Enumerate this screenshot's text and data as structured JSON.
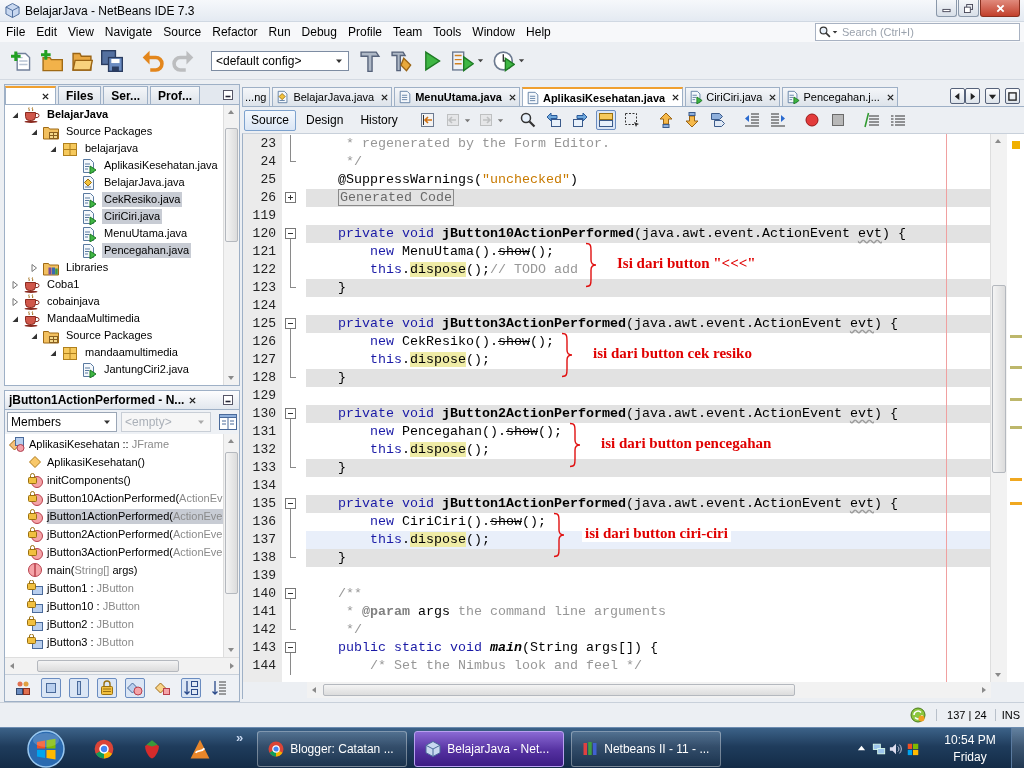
{
  "window": {
    "title": "BelajarJava - NetBeans IDE 7.3"
  },
  "menu": [
    "File",
    "Edit",
    "View",
    "Navigate",
    "Source",
    "Refactor",
    "Run",
    "Debug",
    "Profile",
    "Team",
    "Tools",
    "Window",
    "Help"
  ],
  "search": {
    "placeholder": "Search (Ctrl+I)"
  },
  "toolbar": {
    "file_tools": [
      {
        "kind": "new-file",
        "disabled": false,
        "dropdown": false
      },
      {
        "kind": "new-project",
        "disabled": false,
        "dropdown": false
      },
      {
        "kind": "open-project",
        "disabled": false,
        "dropdown": false
      },
      {
        "kind": "save-all",
        "disabled": false,
        "dropdown": false
      }
    ],
    "edit_tools": [
      {
        "kind": "undo",
        "disabled": false,
        "dropdown": false
      },
      {
        "kind": "redo",
        "disabled": true,
        "dropdown": false
      }
    ],
    "config": "<default config>",
    "run_tools": [
      {
        "kind": "build",
        "disabled": false,
        "dropdown": false
      },
      {
        "kind": "clean-build",
        "disabled": false,
        "dropdown": false
      },
      {
        "kind": "run",
        "disabled": false,
        "dropdown": false
      },
      {
        "kind": "debug",
        "disabled": false,
        "dropdown": true
      },
      {
        "kind": "profile",
        "disabled": false,
        "dropdown": true
      }
    ]
  },
  "projects": {
    "tabs": [
      {
        "selected": true,
        "closable": true
      },
      {
        "label": "Files",
        "selected": false,
        "closable": false
      },
      {
        "label": "Ser...",
        "selected": false,
        "closable": false
      },
      {
        "label": "Prof...",
        "selected": false,
        "closable": false
      }
    ],
    "tree": [
      {
        "label": "BelajarJava",
        "kind": "project",
        "main_project": true,
        "expanded": true,
        "selected": false,
        "children": [
          {
            "label": "Source Packages",
            "kind": "source-root",
            "expanded": true,
            "selected": false,
            "children": [
              {
                "label": "belajarjava",
                "kind": "package",
                "expanded": true,
                "selected": false,
                "children": [
                  {
                    "label": "AplikasiKesehatan.java",
                    "kind": "form",
                    "selected": false
                  },
                  {
                    "label": "BelajarJava.java",
                    "kind": "main",
                    "selected": false
                  },
                  {
                    "label": "CekResiko.java",
                    "kind": "form",
                    "selected": true
                  },
                  {
                    "label": "CiriCiri.java",
                    "kind": "form",
                    "selected": true
                  },
                  {
                    "label": "MenuUtama.java",
                    "kind": "form",
                    "selected": false
                  },
                  {
                    "label": "Pencegahan.java",
                    "kind": "form",
                    "selected": true
                  }
                ]
              }
            ]
          },
          {
            "label": "Libraries",
            "kind": "libraries",
            "expanded": false,
            "selected": false
          }
        ]
      },
      {
        "label": "Coba1",
        "kind": "project",
        "main_project": false,
        "expanded": false,
        "selected": false
      },
      {
        "label": "cobainjava",
        "kind": "project",
        "main_project": false,
        "expanded": false,
        "selected": false
      },
      {
        "label": "MandaaMultimedia",
        "kind": "project",
        "main_project": false,
        "expanded": true,
        "selected": false,
        "children": [
          {
            "label": "Source Packages",
            "kind": "source-root",
            "expanded": true,
            "selected": false,
            "children": [
              {
                "label": "mandaamultimedia",
                "kind": "package",
                "expanded": true,
                "selected": false,
                "children": [
                  {
                    "label": "JantungCiri2.java",
                    "kind": "form",
                    "selected": false
                  }
                ]
              }
            ]
          }
        ]
      }
    ]
  },
  "navigator": {
    "title": "jButton1ActionPerformed - N...",
    "filter": "Members",
    "scope": {
      "value": "<empty>",
      "disabled": true
    },
    "members": [
      {
        "kind": "class",
        "selected": false,
        "parts": [
          {
            "text": "AplikasiKesehatan :: ",
            "muted": false
          },
          {
            "text": "JFrame",
            "muted": true
          }
        ],
        "children": [
          {
            "kind": "constructor",
            "selected": false,
            "parts": [
              {
                "text": "AplikasiKesehatan()",
                "muted": false
              }
            ]
          },
          {
            "kind": "method",
            "selected": false,
            "parts": [
              {
                "text": "initComponents()",
                "muted": false
              }
            ]
          },
          {
            "kind": "method",
            "selected": false,
            "parts": [
              {
                "text": "jButton10ActionPerformed(",
                "muted": false
              },
              {
                "text": "ActionEv",
                "muted": true
              }
            ]
          },
          {
            "kind": "method",
            "selected": true,
            "parts": [
              {
                "text": "jButton1ActionPerformed(",
                "muted": false
              },
              {
                "text": "ActionEve",
                "muted": true
              }
            ]
          },
          {
            "kind": "method",
            "selected": false,
            "parts": [
              {
                "text": "jButton2ActionPerformed(",
                "muted": false
              },
              {
                "text": "ActionEve",
                "muted": true
              }
            ]
          },
          {
            "kind": "method",
            "selected": false,
            "parts": [
              {
                "text": "jButton3ActionPerformed(",
                "muted": false
              },
              {
                "text": "ActionEve",
                "muted": true
              }
            ]
          },
          {
            "kind": "static-method",
            "selected": false,
            "parts": [
              {
                "text": "main(",
                "muted": false
              },
              {
                "text": "String[]",
                "muted": true
              },
              {
                "text": " args)",
                "muted": false
              }
            ]
          },
          {
            "kind": "field",
            "selected": false,
            "parts": [
              {
                "text": "jButton1 : ",
                "muted": false
              },
              {
                "text": "JButton",
                "muted": true
              }
            ]
          },
          {
            "kind": "field",
            "selected": false,
            "parts": [
              {
                "text": "jButton10 : ",
                "muted": false
              },
              {
                "text": "JButton",
                "muted": true
              }
            ]
          },
          {
            "kind": "field",
            "selected": false,
            "parts": [
              {
                "text": "jButton2 : ",
                "muted": false
              },
              {
                "text": "JButton",
                "muted": true
              }
            ]
          },
          {
            "kind": "field",
            "selected": false,
            "parts": [
              {
                "text": "jButton3 : ",
                "muted": false
              },
              {
                "text": "JButton",
                "muted": true
              }
            ]
          }
        ]
      }
    ],
    "tools": [
      {
        "kind": "inherited",
        "pressed": false
      },
      {
        "kind": "fields",
        "pressed": true
      },
      {
        "kind": "static",
        "pressed": true
      },
      {
        "kind": "non-public",
        "pressed": true
      },
      {
        "kind": "inner",
        "pressed": true
      },
      {
        "kind": "javadoc",
        "pressed": false
      },
      {
        "kind": "sort-name",
        "pressed": true
      },
      {
        "kind": "sort-source",
        "pressed": false
      }
    ]
  },
  "editor": {
    "tabs": [
      {
        "label": "...ng",
        "kind": "partial",
        "selected": false,
        "modified": false
      },
      {
        "label": "BelajarJava.java",
        "kind": "main",
        "selected": false,
        "modified": false
      },
      {
        "label": "MenuUtama.java",
        "kind": "file",
        "selected": false,
        "modified": true
      },
      {
        "label": "AplikasiKesehatan.java",
        "kind": "file",
        "selected": true,
        "modified": true
      },
      {
        "label": "CiriCiri.java",
        "kind": "form",
        "selected": false,
        "modified": false
      },
      {
        "label": "Pencegahan.j...",
        "kind": "form",
        "selected": false,
        "modified": false
      }
    ],
    "views": [
      {
        "label": "Source",
        "selected": true
      },
      {
        "label": "Design",
        "selected": false
      },
      {
        "label": "History",
        "selected": false
      }
    ],
    "tool_groups": [
      [
        {
          "kind": "last-edit",
          "disabled": false,
          "pressed": false,
          "dropdown": false
        },
        {
          "kind": "back",
          "disabled": true,
          "pressed": false,
          "dropdown": true
        },
        {
          "kind": "forward",
          "disabled": true,
          "pressed": false,
          "dropdown": true
        }
      ],
      [
        {
          "kind": "find-selection",
          "disabled": false,
          "pressed": false,
          "dropdown": false
        },
        {
          "kind": "find-prev",
          "disabled": false,
          "pressed": false,
          "dropdown": false
        },
        {
          "kind": "find-next",
          "disabled": false,
          "pressed": false,
          "dropdown": false
        },
        {
          "kind": "toggle-highlight",
          "disabled": false,
          "pressed": true,
          "dropdown": false
        },
        {
          "kind": "rect-select",
          "disabled": false,
          "pressed": false,
          "dropdown": false
        }
      ],
      [
        {
          "kind": "prev-bookmark",
          "disabled": false,
          "pressed": false,
          "dropdown": false
        },
        {
          "kind": "next-bookmark",
          "disabled": false,
          "pressed": false,
          "dropdown": false
        },
        {
          "kind": "toggle-bookmark",
          "disabled": false,
          "pressed": false,
          "dropdown": false
        }
      ],
      [
        {
          "kind": "shift-left",
          "disabled": false,
          "pressed": false,
          "dropdown": false
        },
        {
          "kind": "shift-right",
          "disabled": false,
          "pressed": false,
          "dropdown": false
        }
      ],
      [
        {
          "kind": "record",
          "disabled": false,
          "pressed": false,
          "dropdown": false
        },
        {
          "kind": "stop",
          "disabled": false,
          "pressed": false,
          "dropdown": false
        }
      ],
      [
        {
          "kind": "comment",
          "disabled": false,
          "pressed": false,
          "dropdown": false
        },
        {
          "kind": "uncomment",
          "disabled": false,
          "pressed": false,
          "dropdown": false
        }
      ]
    ],
    "lines": [
      {
        "number": "23",
        "kind": "fold-body",
        "guarded": false,
        "current": false,
        "tokens": [
          {
            "text": "     * regenerated by the Form Editor.",
            "kind": "comment"
          }
        ]
      },
      {
        "number": "24",
        "kind": "fold-end",
        "guarded": false,
        "current": false,
        "tokens": [
          {
            "text": "     */",
            "kind": "comment"
          }
        ]
      },
      {
        "number": "25",
        "kind": "plain",
        "guarded": false,
        "current": false,
        "tokens": [
          {
            "text": "    @SuppressWarnings(",
            "kind": "plain"
          },
          {
            "text": "\"unchecked\"",
            "kind": "string"
          },
          {
            "text": ")",
            "kind": "plain"
          }
        ]
      },
      {
        "number": "26",
        "kind": "folded",
        "guarded": true,
        "current": false,
        "tokens": [
          {
            "text": "    Generated Code",
            "kind": "folded"
          }
        ]
      },
      {
        "number": "119",
        "kind": "plain",
        "guarded": false,
        "current": false
      },
      {
        "number": "120",
        "kind": "fold-start",
        "guarded": true,
        "current": false,
        "tokens": [
          {
            "text": "    private void ",
            "kind": "keyword"
          },
          {
            "text": "jButton10ActionPerformed",
            "kind": "declaration"
          },
          {
            "text": "(java.awt.event.ActionEvent ",
            "kind": "plain"
          },
          {
            "text": "evt",
            "kind": "unused"
          },
          {
            "text": ") {",
            "kind": "plain"
          }
        ]
      },
      {
        "number": "121",
        "kind": "fold-body",
        "guarded": false,
        "current": false,
        "tokens": [
          {
            "text": "        new ",
            "kind": "keyword"
          },
          {
            "text": "MenuUtama().",
            "kind": "plain"
          },
          {
            "text": "show",
            "kind": "deprecated"
          },
          {
            "text": "();",
            "kind": "plain"
          }
        ],
        "note": "Isi dari button \"<<<\""
      },
      {
        "number": "122",
        "kind": "fold-body",
        "guarded": false,
        "current": false,
        "tokens": [
          {
            "text": "        this",
            "kind": "keyword"
          },
          {
            "text": ".",
            "kind": "plain"
          },
          {
            "text": "dispose",
            "kind": "occurrence"
          },
          {
            "text": "();",
            "kind": "plain"
          },
          {
            "text": "// TODO add",
            "kind": "comment"
          }
        ]
      },
      {
        "number": "123",
        "kind": "fold-end",
        "guarded": true,
        "current": false,
        "tokens": [
          {
            "text": "    }",
            "kind": "plain"
          }
        ]
      },
      {
        "number": "124",
        "kind": "plain",
        "guarded": false,
        "current": false
      },
      {
        "number": "125",
        "kind": "fold-start",
        "guarded": true,
        "current": false,
        "tokens": [
          {
            "text": "    private void ",
            "kind": "keyword"
          },
          {
            "text": "jButton3ActionPerformed",
            "kind": "declaration"
          },
          {
            "text": "(java.awt.event.ActionEvent ",
            "kind": "plain"
          },
          {
            "text": "evt",
            "kind": "unused"
          },
          {
            "text": ") {",
            "kind": "plain"
          }
        ]
      },
      {
        "number": "126",
        "kind": "fold-body",
        "guarded": false,
        "current": false,
        "tokens": [
          {
            "text": "        new ",
            "kind": "keyword"
          },
          {
            "text": "CekResiko().",
            "kind": "plain"
          },
          {
            "text": "show",
            "kind": "deprecated"
          },
          {
            "text": "();",
            "kind": "plain"
          }
        ],
        "note": "isi dari button cek resiko"
      },
      {
        "number": "127",
        "kind": "fold-body",
        "guarded": false,
        "current": false,
        "tokens": [
          {
            "text": "        this",
            "kind": "keyword"
          },
          {
            "text": ".",
            "kind": "plain"
          },
          {
            "text": "dispose",
            "kind": "occurrence"
          },
          {
            "text": "();",
            "kind": "plain"
          }
        ]
      },
      {
        "number": "128",
        "kind": "fold-end",
        "guarded": true,
        "current": false,
        "tokens": [
          {
            "text": "    }",
            "kind": "plain"
          }
        ]
      },
      {
        "number": "129",
        "kind": "plain",
        "guarded": false,
        "current": false
      },
      {
        "number": "130",
        "kind": "fold-start",
        "guarded": true,
        "current": false,
        "tokens": [
          {
            "text": "    private void ",
            "kind": "keyword"
          },
          {
            "text": "jButton2ActionPerformed",
            "kind": "declaration"
          },
          {
            "text": "(java.awt.event.ActionEvent ",
            "kind": "plain"
          },
          {
            "text": "evt",
            "kind": "unused"
          },
          {
            "text": ") {",
            "kind": "plain"
          }
        ]
      },
      {
        "number": "131",
        "kind": "fold-body",
        "guarded": false,
        "current": false,
        "tokens": [
          {
            "text": "        new ",
            "kind": "keyword"
          },
          {
            "text": "Pencegahan().",
            "kind": "plain"
          },
          {
            "text": "show",
            "kind": "deprecated"
          },
          {
            "text": "();",
            "kind": "plain"
          }
        ],
        "note": "isi dari button pencegahan"
      },
      {
        "number": "132",
        "kind": "fold-body",
        "guarded": false,
        "current": false,
        "tokens": [
          {
            "text": "        this",
            "kind": "keyword"
          },
          {
            "text": ".",
            "kind": "plain"
          },
          {
            "text": "dispose",
            "kind": "occurrence"
          },
          {
            "text": "();",
            "kind": "plain"
          }
        ]
      },
      {
        "number": "133",
        "kind": "fold-end",
        "guarded": true,
        "current": false,
        "tokens": [
          {
            "text": "    }",
            "kind": "plain"
          }
        ]
      },
      {
        "number": "134",
        "kind": "plain",
        "guarded": false,
        "current": false
      },
      {
        "number": "135",
        "kind": "fold-start",
        "guarded": true,
        "current": false,
        "tokens": [
          {
            "text": "    private void ",
            "kind": "keyword"
          },
          {
            "text": "jButton1ActionPerformed",
            "kind": "declaration"
          },
          {
            "text": "(java.awt.event.ActionEvent ",
            "kind": "plain"
          },
          {
            "text": "evt",
            "kind": "unused"
          },
          {
            "text": ") {",
            "kind": "plain"
          }
        ]
      },
      {
        "number": "136",
        "kind": "fold-body",
        "guarded": false,
        "current": false,
        "tokens": [
          {
            "text": "        new ",
            "kind": "keyword"
          },
          {
            "text": "CiriCiri().",
            "kind": "plain"
          },
          {
            "text": "show",
            "kind": "deprecated"
          },
          {
            "text": "();",
            "kind": "plain"
          }
        ],
        "note": "isi dari button ciri-ciri"
      },
      {
        "number": "137",
        "kind": "fold-body",
        "guarded": false,
        "current": true,
        "tokens": [
          {
            "text": "        this",
            "kind": "keyword"
          },
          {
            "text": ".",
            "kind": "plain"
          },
          {
            "text": "dispose",
            "kind": "occurrence"
          },
          {
            "text": "();",
            "kind": "plain"
          }
        ]
      },
      {
        "number": "138",
        "kind": "fold-end",
        "guarded": true,
        "current": false,
        "tokens": [
          {
            "text": "    }",
            "kind": "plain"
          }
        ]
      },
      {
        "number": "139",
        "kind": "plain",
        "guarded": false,
        "current": false
      },
      {
        "number": "140",
        "kind": "fold-start",
        "guarded": false,
        "current": false,
        "tokens": [
          {
            "text": "    /**",
            "kind": "comment"
          }
        ]
      },
      {
        "number": "141",
        "kind": "fold-body",
        "guarded": false,
        "current": false,
        "tokens": [
          {
            "text": "     * ",
            "kind": "comment"
          },
          {
            "text": "@param",
            "kind": "doc-tag"
          },
          {
            "text": " args",
            "kind": "doc-param"
          },
          {
            "text": " the command line arguments",
            "kind": "comment"
          }
        ]
      },
      {
        "number": "142",
        "kind": "fold-end",
        "guarded": false,
        "current": false,
        "tokens": [
          {
            "text": "     */",
            "kind": "comment"
          }
        ]
      },
      {
        "number": "143",
        "kind": "fold-start",
        "guarded": false,
        "current": false,
        "tokens": [
          {
            "text": "    public static void ",
            "kind": "keyword"
          },
          {
            "text": "main",
            "kind": "static-declaration"
          },
          {
            "text": "(String args[]) {",
            "kind": "plain"
          }
        ]
      },
      {
        "number": "144",
        "kind": "fold-body",
        "guarded": false,
        "current": false,
        "tokens": [
          {
            "text": "        /* Set the Nimbus look and feel */",
            "kind": "comment"
          }
        ]
      }
    ]
  },
  "status_bar": {
    "position": "137 | 24",
    "mode": "INS"
  },
  "taskbar": {
    "pinned": [
      {
        "kind": "browser"
      },
      {
        "kind": "strawberry"
      },
      {
        "kind": "app"
      }
    ],
    "overflow": "»",
    "tasks": [
      {
        "label": "Blogger: Catatan ...",
        "kind": "browser",
        "selected": false
      },
      {
        "label": "BelajarJava - Net...",
        "kind": "cube",
        "selected": true
      },
      {
        "label": "Netbeans II - 11 - ...",
        "kind": "media",
        "selected": false
      }
    ],
    "clock": {
      "time": "10:54 PM",
      "day": "Friday"
    }
  }
}
